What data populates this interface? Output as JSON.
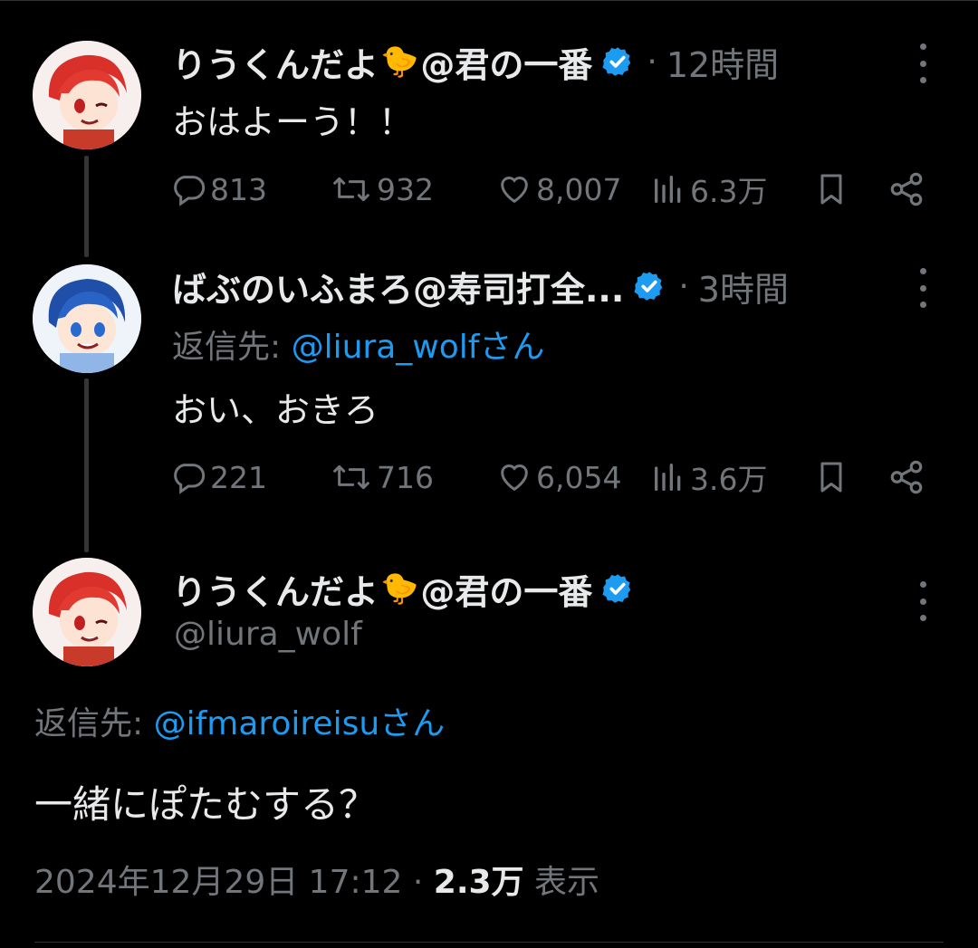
{
  "tweets": [
    {
      "display_name": "りうくんだよ",
      "name_emoji": "🐤",
      "name_suffix": "@君の一番",
      "time": "12時間",
      "text": "おはよーう！！",
      "replies": "813",
      "retweets": "932",
      "likes": "8,007",
      "views": "6.3万"
    },
    {
      "display_name": "ばぶのいふまろ@寿司打全...",
      "time": "3時間",
      "reply_prefix": "返信先: ",
      "reply_mention": "@liura_wolf",
      "reply_suffix": "さん",
      "text": "おい、おきろ",
      "replies": "221",
      "retweets": "716",
      "likes": "6,054",
      "views": "3.6万"
    }
  ],
  "main_tweet": {
    "display_name": "りうくんだよ",
    "name_emoji": "🐤",
    "name_suffix": "@君の一番",
    "handle": "@liura_wolf",
    "reply_prefix": "返信先: ",
    "reply_mention": "@ifmaroireisu",
    "reply_suffix": "さん",
    "text": "一緒にぽたむする？",
    "date": "2024年12月29日 17:12",
    "separator": " · ",
    "views": "2.3万",
    "views_label": " 表示"
  },
  "colors": {
    "background": "#000000",
    "text": "#e7e9ea",
    "muted": "#71767b",
    "accent": "#1d9bf0"
  },
  "icons": [
    "reply-icon",
    "retweet-icon",
    "like-icon",
    "views-icon",
    "bookmark-icon",
    "share-icon",
    "verified-badge-icon",
    "more-icon"
  ]
}
